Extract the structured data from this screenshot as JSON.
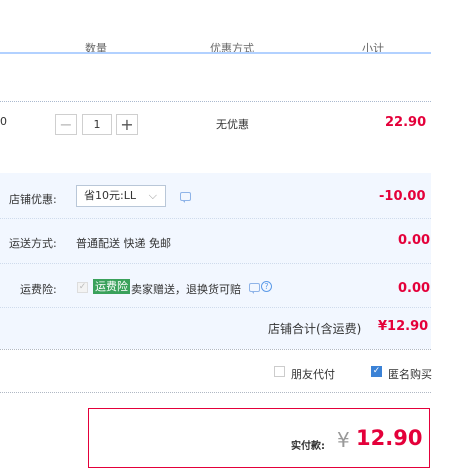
{
  "header": {
    "col_quantity": "数量",
    "col_discount": "优惠方式",
    "col_subtotal": "小计"
  },
  "item": {
    "partial_text": "0",
    "minus_label": "−",
    "quantity": "1",
    "plus_label": "+",
    "discount": "无优惠",
    "subtotal": "22.90"
  },
  "shop": {
    "coupon_label": "店铺优惠:",
    "coupon_selected": "省10元:LL",
    "coupon_amount": "-10.00",
    "shipping_label": "运送方式:",
    "shipping_value": "普通配送 快递 免邮",
    "shipping_amount": "0.00",
    "insurance_label": "运费险:",
    "insurance_tag": "运费险",
    "insurance_desc": "卖家赠送，退换货可赔",
    "insurance_amount": "0.00",
    "total_label": "店铺合计(含运费)",
    "total_value": "¥12.90"
  },
  "options": {
    "friend_pay_label": "朋友代付",
    "anonymous_label": "匿名购买"
  },
  "payment": {
    "label": "实付款:",
    "currency": "¥",
    "amount": "12.90"
  },
  "colors": {
    "accent_red": "#e4003a",
    "shop_bg": "#f2f7ff",
    "header_line": "#b2d1ff",
    "insurance_green": "#3aa15b",
    "checkbox_blue": "#3b82d6"
  },
  "icons": {
    "chevron": "chevron-down-icon",
    "chat": "chat-bubble-icon",
    "help": "question-circle-icon",
    "check": "check-icon"
  }
}
